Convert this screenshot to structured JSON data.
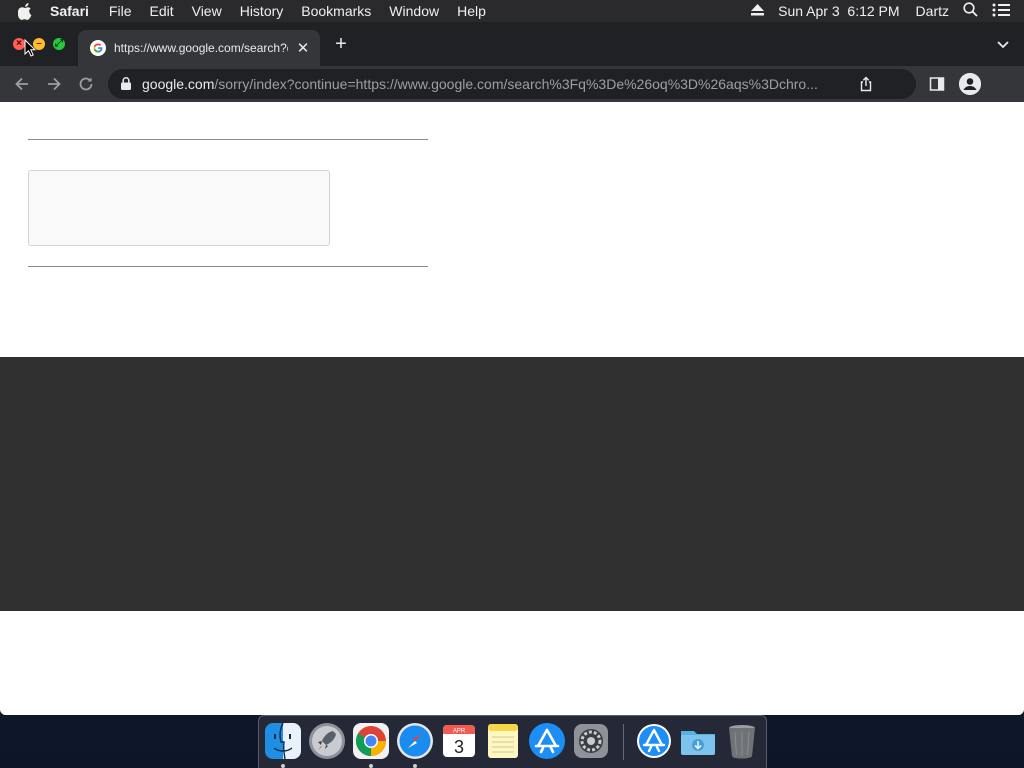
{
  "menubar": {
    "app_name": "Safari",
    "items": [
      "File",
      "Edit",
      "View",
      "History",
      "Bookmarks",
      "Window",
      "Help"
    ],
    "clock": "Sun Apr 3  6:12 PM",
    "user": "Dartz",
    "icons": [
      "apple-icon",
      "eject-icon",
      "spotlight-search-icon",
      "control-center-icon"
    ]
  },
  "browser": {
    "tab": {
      "title": "https://www.google.com/search?q=&oq=&aqs=chrome",
      "favicon": "google-g-icon"
    },
    "url": {
      "host": "google.com",
      "path": "/sorry/index?continue=https://www.google.com/search%3Fq%3De%26oq%3D%26aqs%3Dchro..."
    }
  },
  "dock": {
    "items": [
      {
        "name": "finder",
        "icon": "finder-icon",
        "running": true
      },
      {
        "name": "launchpad",
        "icon": "launchpad-icon",
        "running": false
      },
      {
        "name": "chrome",
        "icon": "chrome-icon",
        "running": true
      },
      {
        "name": "safari",
        "icon": "safari-icon",
        "running": true
      },
      {
        "name": "calendar",
        "icon": "calendar-icon",
        "running": false,
        "month": "APR",
        "day": "3"
      },
      {
        "name": "notes",
        "icon": "notes-icon",
        "running": false
      },
      {
        "name": "app-store",
        "icon": "app-store-icon",
        "running": false
      },
      {
        "name": "system-preferences",
        "icon": "system-preferences-icon",
        "running": false
      },
      {
        "name": "applications-folder",
        "icon": "applications-folder-icon",
        "running": false
      },
      {
        "name": "downloads-folder",
        "icon": "downloads-folder-icon",
        "running": false
      },
      {
        "name": "trash",
        "icon": "trash-icon",
        "running": false
      }
    ]
  },
  "colors": {
    "menubar_bg": "#2a2a2c",
    "tabbar_bg": "#202124",
    "toolbar_bg": "#35363a",
    "content_bg": "#ffffff",
    "dark_band": "#303030"
  }
}
